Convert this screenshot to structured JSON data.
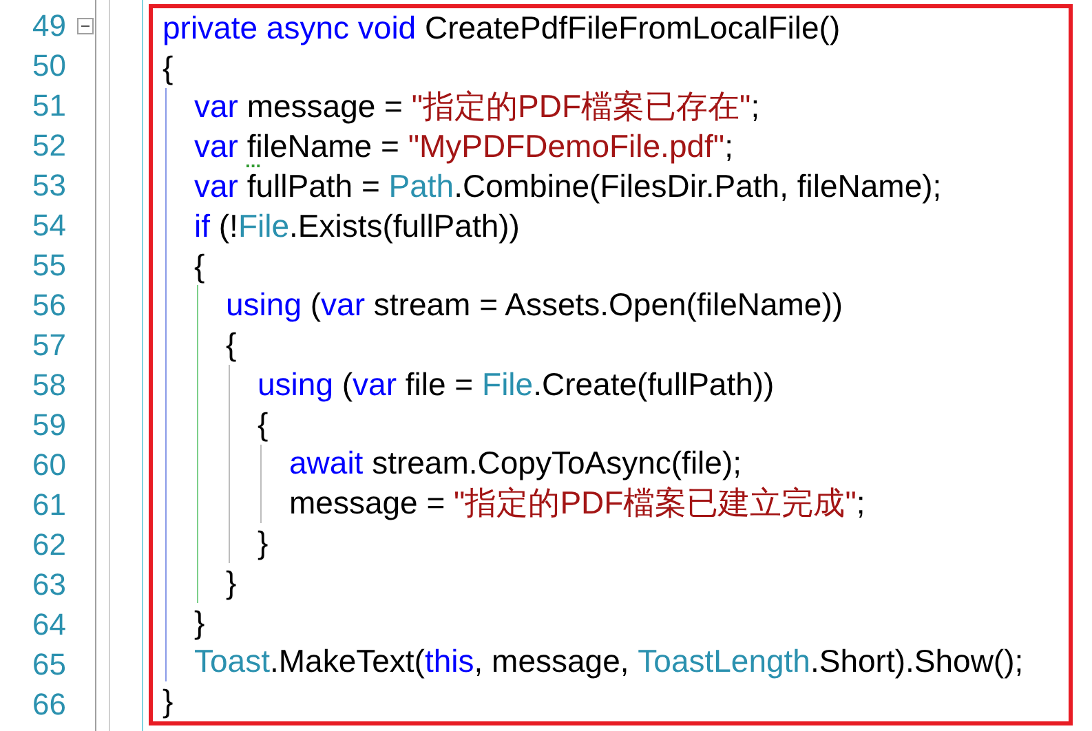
{
  "editor": {
    "lines": [
      {
        "number": "49",
        "fold": true,
        "tokens": [
          {
            "kind": "kw",
            "text": "private async void"
          },
          {
            "kind": "plain",
            "text": " CreatePdfFileFromLocalFile()"
          }
        ]
      },
      {
        "number": "50",
        "fold": false,
        "tokens": [
          {
            "kind": "plain",
            "text": "{"
          }
        ],
        "children": [
          {
            "number": "51",
            "fold": false,
            "tokens": [
              {
                "kind": "kw",
                "text": "var"
              },
              {
                "kind": "plain",
                "text": " message = "
              },
              {
                "kind": "str",
                "text": "\"指定的PDF檔案已存在\""
              },
              {
                "kind": "plain",
                "text": ";"
              }
            ]
          },
          {
            "number": "52",
            "fold": false,
            "tokens": [
              {
                "kind": "kw",
                "text": "var "
              },
              {
                "kind": "plain",
                "text": "fi",
                "squiggle": true
              },
              {
                "kind": "plain",
                "text": "leName = "
              },
              {
                "kind": "str",
                "text": "\"MyPDFDemoFile.pdf\""
              },
              {
                "kind": "plain",
                "text": ";"
              }
            ]
          },
          {
            "number": "53",
            "fold": false,
            "tokens": [
              {
                "kind": "kw",
                "text": "var"
              },
              {
                "kind": "plain",
                "text": " fullPath = "
              },
              {
                "kind": "type",
                "text": "Path"
              },
              {
                "kind": "plain",
                "text": ".Combine(FilesDir.Path, fileName);"
              }
            ]
          },
          {
            "number": "54",
            "fold": false,
            "tokens": [
              {
                "kind": "kw",
                "text": "if"
              },
              {
                "kind": "plain",
                "text": " (!"
              },
              {
                "kind": "type",
                "text": "File"
              },
              {
                "kind": "plain",
                "text": ".Exists(fullPath))"
              }
            ]
          },
          {
            "number": "55",
            "fold": false,
            "tokens": [
              {
                "kind": "plain",
                "text": "{"
              }
            ],
            "children": [
              {
                "number": "56",
                "fold": false,
                "tokens": [
                  {
                    "kind": "kw",
                    "text": "using"
                  },
                  {
                    "kind": "plain",
                    "text": " ("
                  },
                  {
                    "kind": "kw",
                    "text": "var"
                  },
                  {
                    "kind": "plain",
                    "text": " stream = Assets.Open(fileName))"
                  }
                ]
              },
              {
                "number": "57",
                "fold": false,
                "tokens": [
                  {
                    "kind": "plain",
                    "text": "{"
                  }
                ],
                "children": [
                  {
                    "number": "58",
                    "fold": false,
                    "tokens": [
                      {
                        "kind": "kw",
                        "text": "using"
                      },
                      {
                        "kind": "plain",
                        "text": " ("
                      },
                      {
                        "kind": "kw",
                        "text": "var"
                      },
                      {
                        "kind": "plain",
                        "text": " file = "
                      },
                      {
                        "kind": "type",
                        "text": "File"
                      },
                      {
                        "kind": "plain",
                        "text": ".Create(fullPath))"
                      }
                    ]
                  },
                  {
                    "number": "59",
                    "fold": false,
                    "tokens": [
                      {
                        "kind": "plain",
                        "text": "{"
                      }
                    ],
                    "children": [
                      {
                        "number": "60",
                        "fold": false,
                        "tokens": [
                          {
                            "kind": "kw",
                            "text": "await"
                          },
                          {
                            "kind": "plain",
                            "text": " stream.CopyToAsync(file);"
                          }
                        ]
                      },
                      {
                        "number": "61",
                        "fold": false,
                        "tokens": [
                          {
                            "kind": "plain",
                            "text": "message = "
                          },
                          {
                            "kind": "str",
                            "text": "\"指定的PDF檔案已建立完成\""
                          },
                          {
                            "kind": "plain",
                            "text": ";"
                          }
                        ]
                      }
                    ]
                  },
                  {
                    "number": "62",
                    "fold": false,
                    "tokens": [
                      {
                        "kind": "plain",
                        "text": "}"
                      }
                    ]
                  }
                ]
              },
              {
                "number": "63",
                "fold": false,
                "tokens": [
                  {
                    "kind": "plain",
                    "text": "}"
                  }
                ]
              }
            ]
          },
          {
            "number": "64",
            "fold": false,
            "tokens": [
              {
                "kind": "plain",
                "text": "}"
              }
            ]
          },
          {
            "number": "65",
            "fold": false,
            "tokens": [
              {
                "kind": "type",
                "text": "Toast"
              },
              {
                "kind": "plain",
                "text": ".MakeText("
              },
              {
                "kind": "kw",
                "text": "this"
              },
              {
                "kind": "plain",
                "text": ", message, "
              },
              {
                "kind": "type",
                "text": "ToastLength"
              },
              {
                "kind": "plain",
                "text": ".Short).Show();"
              }
            ]
          }
        ]
      },
      {
        "number": "66",
        "fold": false,
        "tokens": [
          {
            "kind": "plain",
            "text": "}"
          }
        ]
      }
    ]
  }
}
